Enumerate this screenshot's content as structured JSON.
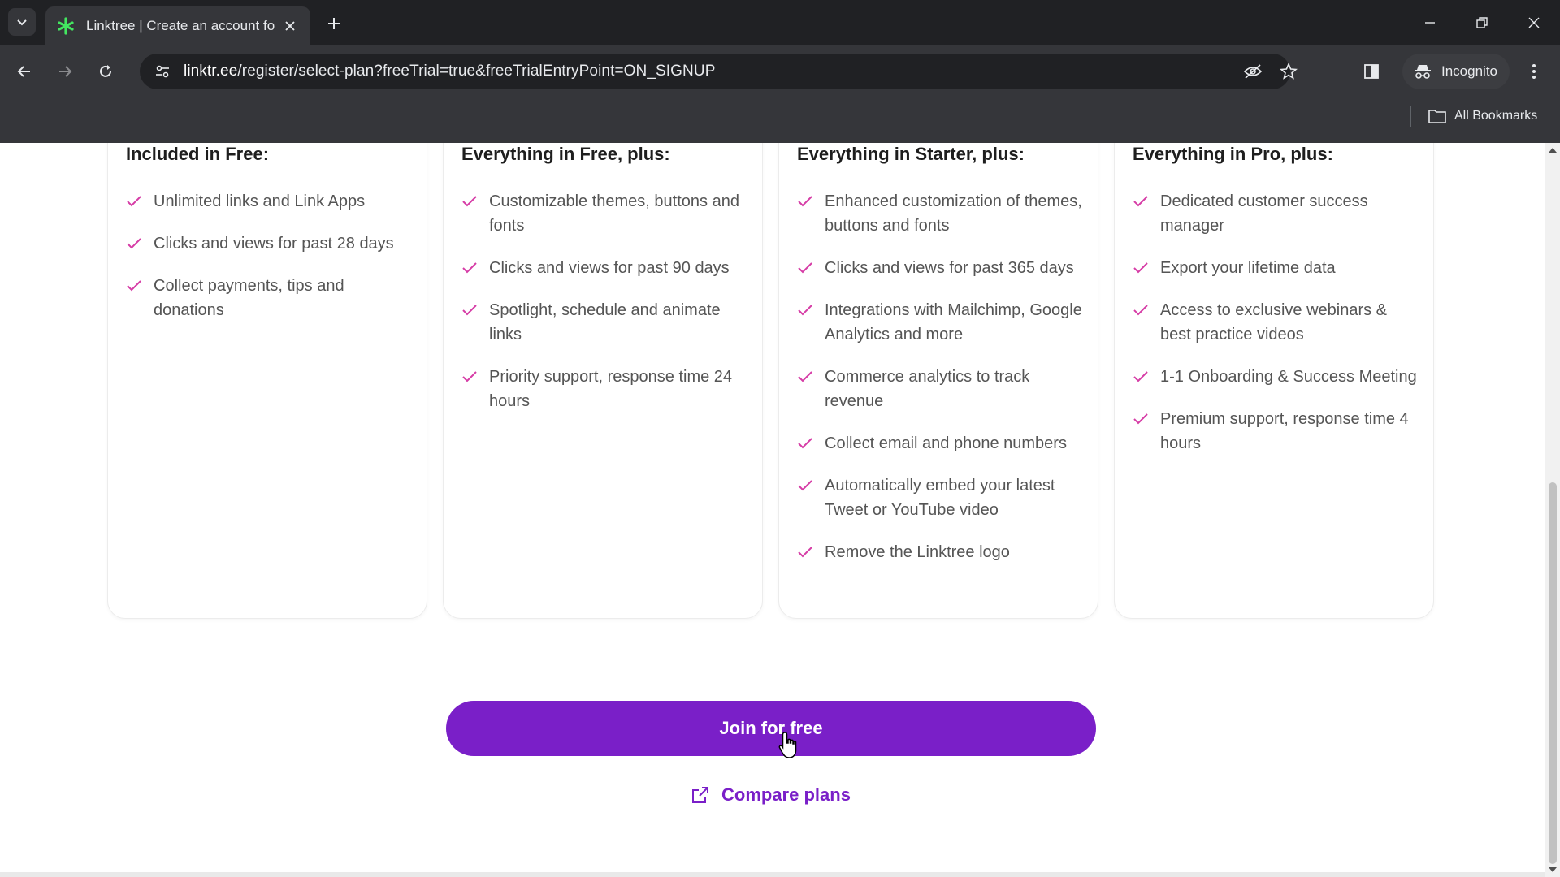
{
  "browser": {
    "tab_title": "Linktree | Create an account for",
    "url_domain": "linktr.ee",
    "url_path": "/register/select-plan?freeTrial=true&freeTrialEntryPoint=ON_SIGNUP",
    "incognito_label": "Incognito",
    "bookmarks_label": "All Bookmarks"
  },
  "plans": [
    {
      "heading": "Included in Free:",
      "features": [
        "Unlimited links and Link Apps",
        "Clicks and views for past 28 days",
        "Collect payments, tips and donations"
      ]
    },
    {
      "heading": "Everything in Free, plus:",
      "features": [
        "Customizable themes, buttons and fonts",
        "Clicks and views for past 90 days",
        "Spotlight, schedule and animate links",
        "Priority support, response time 24 hours"
      ]
    },
    {
      "heading": "Everything in Starter, plus:",
      "features": [
        "Enhanced customization of themes, buttons and fonts",
        "Clicks and views for past 365 days",
        "Integrations with Mailchimp, Google Analytics and more",
        "Commerce analytics to track revenue",
        "Collect email and phone numbers",
        "Automatically embed your latest Tweet or YouTube video",
        "Remove the Linktree logo"
      ]
    },
    {
      "heading": "Everything in Pro, plus:",
      "features": [
        "Dedicated customer success manager",
        "Export your lifetime data",
        "Access to exclusive webinars & best practice videos",
        "1-1 Onboarding & Success Meeting",
        "Premium support, response time 4 hours"
      ]
    }
  ],
  "actions": {
    "join_label": "Join for free",
    "compare_label": "Compare plans"
  },
  "colors": {
    "accent": "#7a1fc8",
    "check": "#d63ca6"
  }
}
